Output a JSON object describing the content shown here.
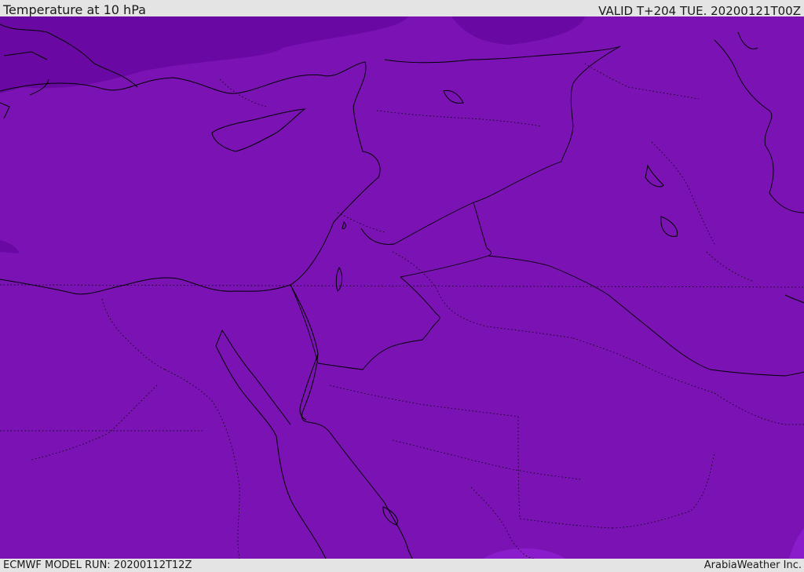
{
  "header": {
    "title": "Temperature at 10 hPa",
    "valid": "VALID T+204 TUE. 20200121T00Z"
  },
  "footer": {
    "model_run": "ECMWF MODEL RUN: 20200112T12Z",
    "brand": "ArabiaWeather Inc."
  },
  "map": {
    "variable": "temperature",
    "level": "10 hPa",
    "colors": {
      "base_fill": "#7a12b4",
      "colder_fill": "#6a08a3",
      "warmer_fill": "#8a1ccc",
      "coastline": "#000000",
      "borders": "#000000"
    }
  }
}
